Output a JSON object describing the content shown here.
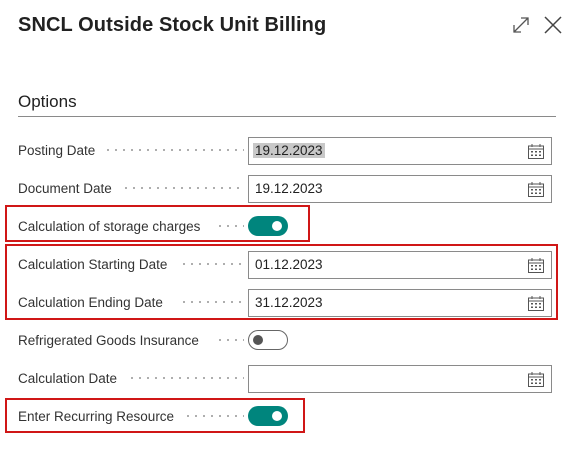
{
  "dialog": {
    "title": "SNCL Outside Stock Unit Billing",
    "expand_icon": "expand-icon",
    "close_icon": "close-icon"
  },
  "options": {
    "section_title": "Options",
    "posting_date": {
      "label": "Posting Date",
      "value": "19.12.2023"
    },
    "document_date": {
      "label": "Document Date",
      "value": "19.12.2023"
    },
    "calc_storage_charges": {
      "label": "Calculation of storage charges",
      "on": true
    },
    "calc_starting_date": {
      "label": "Calculation Starting Date",
      "value": "01.12.2023"
    },
    "calc_ending_date": {
      "label": "Calculation Ending Date",
      "value": "31.12.2023"
    },
    "refrigerated_insurance": {
      "label": "Refrigerated Goods Insurance",
      "on": false
    },
    "calculation_date": {
      "label": "Calculation Date",
      "value": ""
    },
    "enter_recurring_resource": {
      "label": "Enter Recurring Resource",
      "on": true
    }
  },
  "colors": {
    "toggle_on": "#00857d",
    "highlight": "#d01717"
  }
}
